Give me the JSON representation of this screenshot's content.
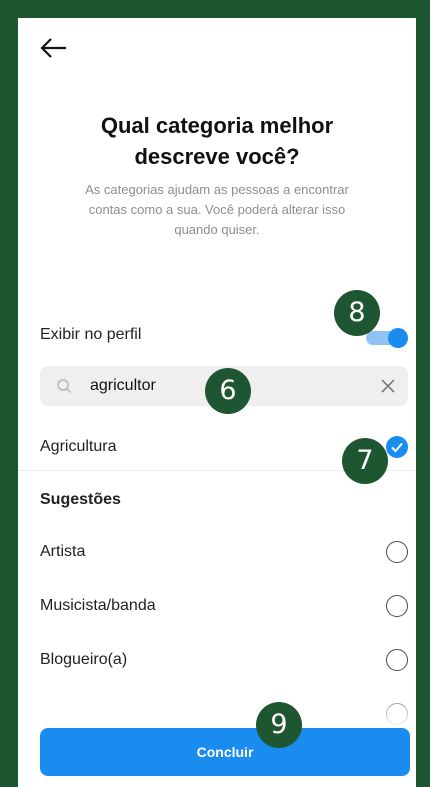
{
  "header": {
    "back_icon": "arrow-left-icon"
  },
  "title_lines": [
    "Qual categoria melhor",
    "descreve você?"
  ],
  "subtitle_lines": [
    "As categorias ajudam as pessoas a encontrar",
    "contas como a sua. Você poderá alterar isso",
    "quando quiser."
  ],
  "profile_toggle": {
    "label": "Exibir no perfil",
    "on": true
  },
  "search": {
    "value": "agricultor",
    "icon": "search-icon",
    "clear_icon": "close-icon"
  },
  "selected_result": {
    "label": "Agricultura",
    "checked": true
  },
  "suggestions": {
    "header": "Sugestões",
    "items": [
      {
        "label": "Artista",
        "checked": false
      },
      {
        "label": "Musicista/banda",
        "checked": false
      },
      {
        "label": "Blogueiro(a)",
        "checked": false
      }
    ]
  },
  "footer": {
    "done_label": "Concluir"
  },
  "markers": [
    "8",
    "6",
    "7",
    "9"
  ],
  "colors": {
    "accent": "#1a8cf0",
    "marker": "#1f5632",
    "frame": "#1e5631"
  }
}
